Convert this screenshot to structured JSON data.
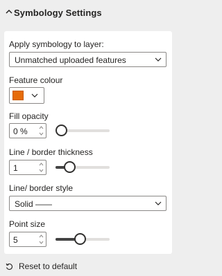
{
  "header": {
    "title": "Symbology Settings",
    "icon": "chevron-up-icon"
  },
  "apply_layer": {
    "label": "Apply symbology to layer:",
    "value": "Unmatched uploaded features"
  },
  "feature_colour": {
    "label": "Feature colour",
    "color": "#e66c0a"
  },
  "fill_opacity": {
    "label": "Fill opacity",
    "value": "0 %",
    "slider_fraction": 0.0
  },
  "line_thickness": {
    "label": "Line / border thickness",
    "value": "1",
    "slider_fraction": 0.2
  },
  "line_style": {
    "label": "Line/ border style",
    "value": "Solid ——"
  },
  "point_size": {
    "label": "Point size",
    "value": "5",
    "slider_fraction": 0.45
  },
  "reset": {
    "label": "Reset to default",
    "icon": "reset-icon"
  },
  "colors": {
    "background": "#eeeeee",
    "card": "#ffffff",
    "accent_swatch": "#e66c0a",
    "slider_fill": "#444444"
  }
}
